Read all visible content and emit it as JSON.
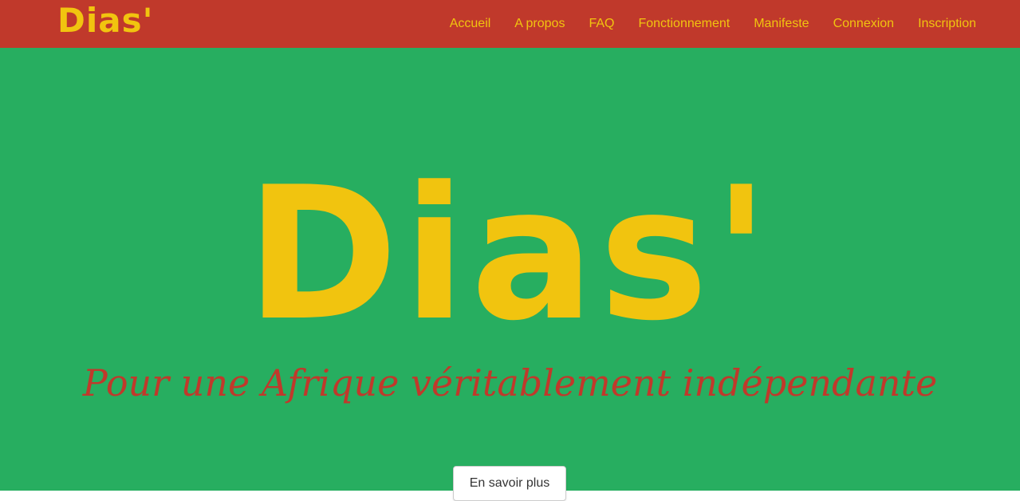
{
  "brand": "Dias'",
  "nav": {
    "items": [
      {
        "label": "Accueil"
      },
      {
        "label": "A propos"
      },
      {
        "label": "FAQ"
      },
      {
        "label": "Fonctionnement"
      },
      {
        "label": "Manifeste"
      },
      {
        "label": "Connexion"
      },
      {
        "label": "Inscription"
      }
    ]
  },
  "hero": {
    "title": "Dias'",
    "subtitle": "Pour une Afrique véritablement indépendante",
    "button_label": "En savoir plus"
  },
  "colors": {
    "header_bg": "#c0392b",
    "hero_bg": "#27ae60",
    "accent_yellow": "#f1c40f",
    "subtitle_red": "#c0392b"
  }
}
